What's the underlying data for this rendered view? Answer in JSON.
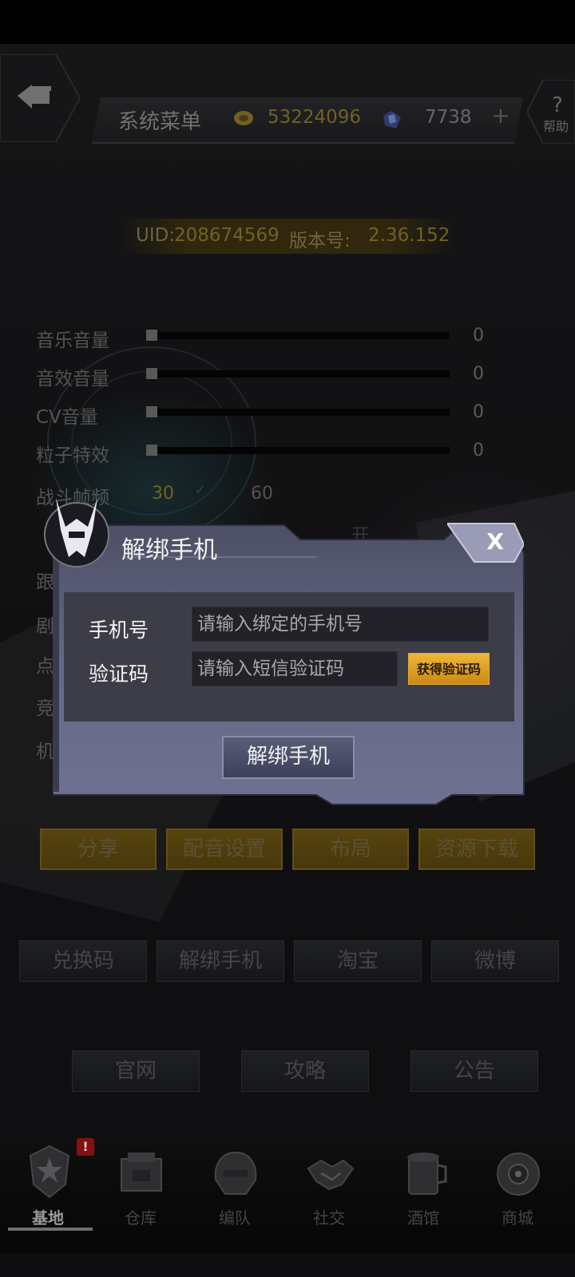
{
  "header": {
    "title": "系统菜单",
    "coins": "53224096",
    "gems": "7738",
    "plus": "+",
    "help": "帮助"
  },
  "info": {
    "uid_label": "UID:",
    "uid": "208674569",
    "version_label": "版本号:",
    "version": "2.36.152"
  },
  "settings": {
    "sliders": [
      {
        "label": "音乐音量",
        "value": "0"
      },
      {
        "label": "音效音量",
        "value": "0"
      },
      {
        "label": "CV音量",
        "value": "0"
      },
      {
        "label": "粒子特效",
        "value": "0"
      }
    ],
    "fps_label": "战斗帧频",
    "fps_options": [
      "30",
      "60"
    ],
    "fps_selected": "30",
    "toggle_on": "开",
    "hidden_rows": [
      "跟",
      "剧",
      "点",
      "竞",
      "机"
    ]
  },
  "buttons_row1": [
    "分享",
    "配音设置",
    "布局",
    "资源下载"
  ],
  "buttons_row2": [
    "兑换码",
    "解绑手机",
    "淘宝",
    "微博"
  ],
  "buttons_row3": [
    "官网",
    "攻略",
    "公告"
  ],
  "nav": [
    {
      "label": "基地",
      "icon": "base-emblem-icon",
      "active": true,
      "badge": "!"
    },
    {
      "label": "仓库",
      "icon": "warehouse-icon"
    },
    {
      "label": "编队",
      "icon": "mech-helmet-icon"
    },
    {
      "label": "社交",
      "icon": "handshake-icon"
    },
    {
      "label": "酒馆",
      "icon": "tavern-icon"
    },
    {
      "label": "商城",
      "icon": "shop-icon"
    }
  ],
  "dialog": {
    "title": "解绑手机",
    "phone_label": "手机号",
    "phone_placeholder": "请输入绑定的手机号",
    "code_label": "验证码",
    "code_placeholder": "请输入短信验证码",
    "get_code": "获得验证码",
    "submit": "解绑手机",
    "close": "X"
  },
  "colors": {
    "gold": "#c9a33a",
    "dialog_panel": "#555872",
    "button_gold": "#e8a82e"
  }
}
